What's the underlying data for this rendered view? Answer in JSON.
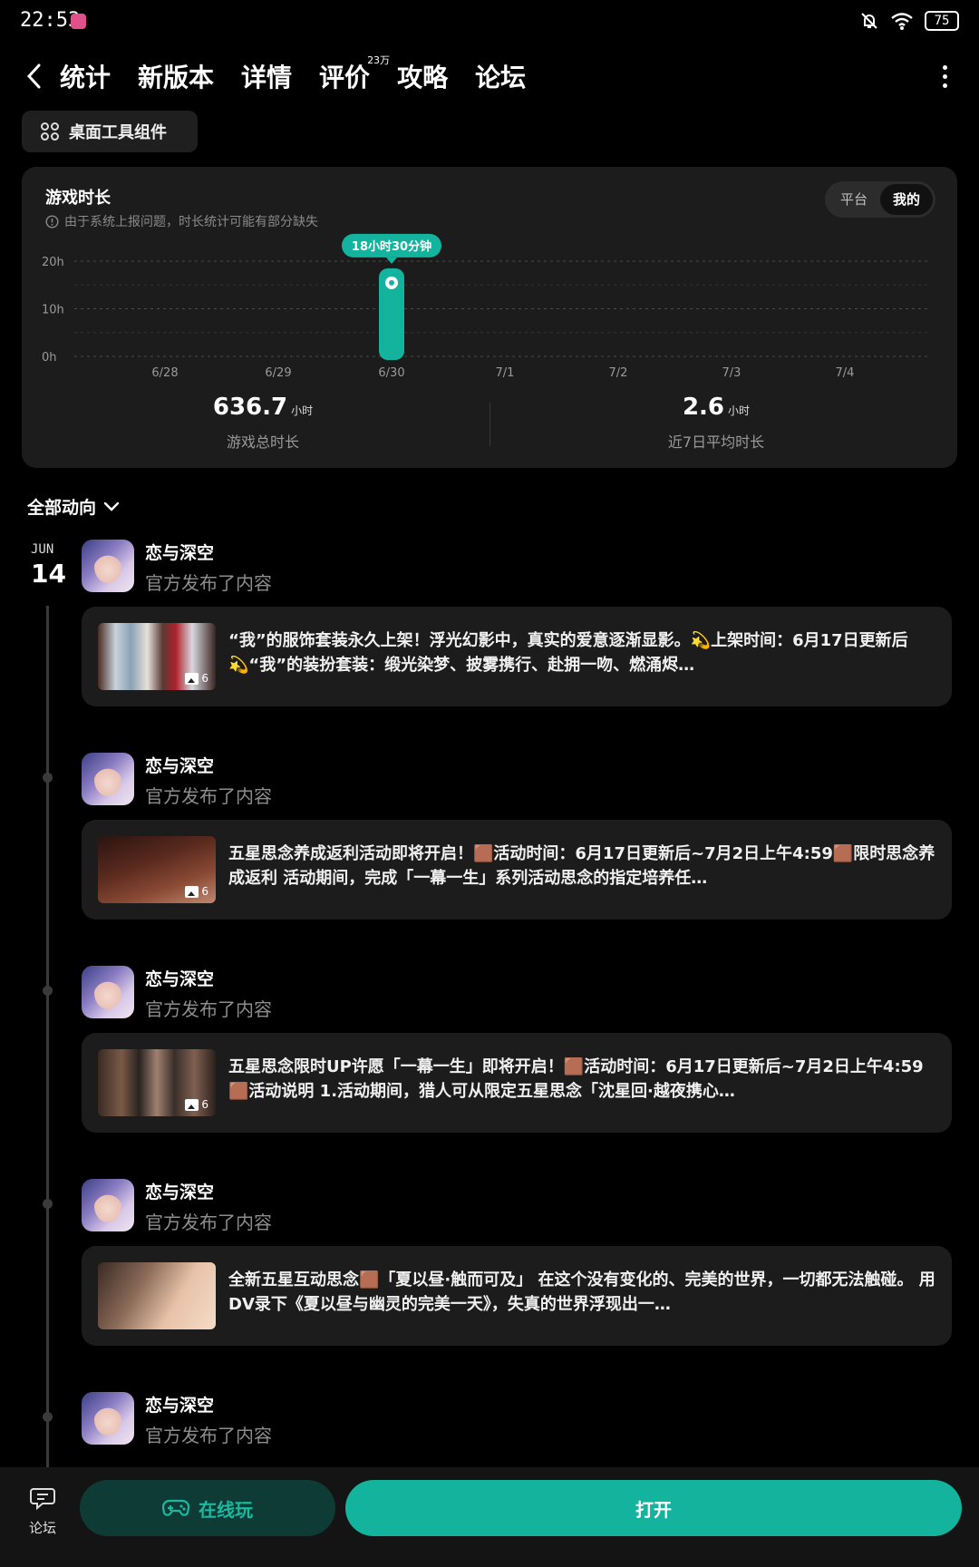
{
  "status_bar": {
    "time": "22:53",
    "battery": "75"
  },
  "nav": {
    "tabs": [
      {
        "label": "统计",
        "active": true
      },
      {
        "label": "新版本"
      },
      {
        "label": "详情"
      },
      {
        "label": "评价",
        "badge": "23万"
      },
      {
        "label": "攻略"
      },
      {
        "label": "论坛"
      }
    ]
  },
  "widget_button": {
    "label": "桌面工具组件"
  },
  "stats": {
    "title": "游戏时长",
    "note": "由于系统上报问题，时长统计可能有部分缺失",
    "segments": [
      "平台",
      "我的"
    ],
    "active_segment": "我的",
    "total_value": "636.7",
    "total_unit": "小时",
    "total_label": "游戏总时长",
    "avg_value": "2.6",
    "avg_unit": "小时",
    "avg_label": "近7日平均时长"
  },
  "chart_data": {
    "type": "bar",
    "categories": [
      "6/28",
      "6/29",
      "6/30",
      "7/1",
      "7/2",
      "7/3",
      "7/4"
    ],
    "values": [
      0,
      0,
      18.5,
      0,
      0,
      0,
      0
    ],
    "y_ticks": [
      "0h",
      "10h",
      "20h"
    ],
    "ylim": [
      0,
      20
    ],
    "highlight_index": 2,
    "tooltip": "18小时30分钟",
    "grid": true,
    "color": "#14b39d"
  },
  "filter": {
    "label": "全部动向"
  },
  "feed": {
    "date_month": "JUN",
    "date_day": "14",
    "posts": [
      {
        "author": "恋与深空",
        "subtitle": "官方发布了内容",
        "image_count": "6",
        "text": "“我”的服饰套装永久上架！浮光幻影中，真实的爱意逐渐显影。💫上架时间：6月17日更新后💫“我”的装扮套装：缎光染梦、披雾携行、赴拥一吻、燃涌烬…"
      },
      {
        "author": "恋与深空",
        "subtitle": "官方发布了内容",
        "image_count": "6",
        "text": "五星思念养成返利活动即将开启！🟫活动时间：6月17日更新后~7月2日上午4:59🟫限时思念养成返利 活动期间，完成「一幕一生」系列活动思念的指定培养任…"
      },
      {
        "author": "恋与深空",
        "subtitle": "官方发布了内容",
        "image_count": "6",
        "text": "五星思念限时UP许愿「一幕一生」即将开启！🟫活动时间：6月17日更新后~7月2日上午4:59🟫活动说明 1.活动期间，猎人可从限定五星思念「沈星回·越夜携心…"
      },
      {
        "author": "恋与深空",
        "subtitle": "官方发布了内容",
        "image_count": "",
        "text": "全新五星互动思念🟫「夏以昼·触而可及」 在这个没有变化的、完美的世界，一切都无法触碰。 用DV录下《夏以昼与幽灵的完美一天》，失真的世界浮现出一…"
      },
      {
        "author": "恋与深空",
        "subtitle": "官方发布了内容"
      }
    ]
  },
  "bottom_bar": {
    "forum_label": "论坛",
    "online_label": "在线玩",
    "open_label": "打开"
  }
}
